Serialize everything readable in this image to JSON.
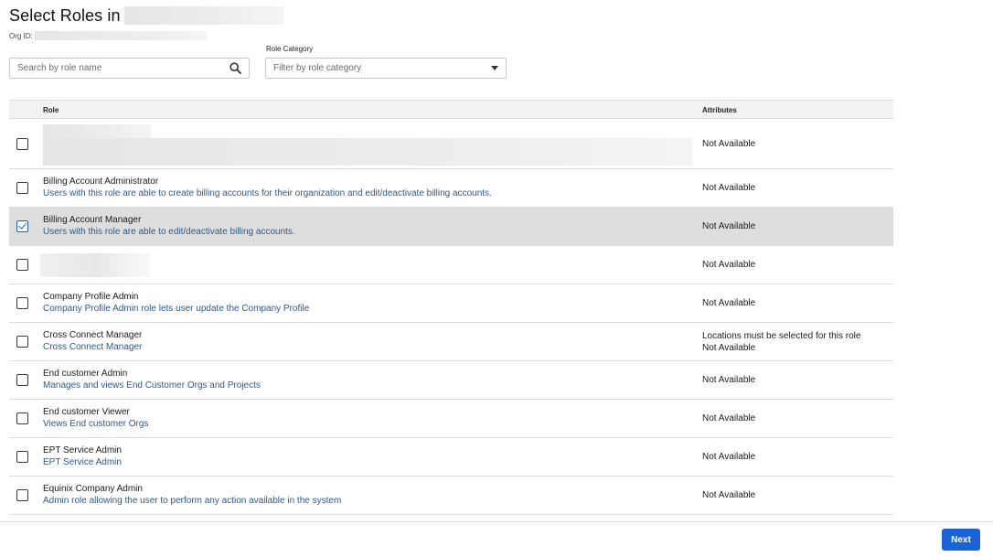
{
  "header": {
    "title": "Select Roles in",
    "org_id_label": "Org ID:"
  },
  "filters": {
    "search_placeholder": "Search by role name",
    "category_label": "Role Category",
    "category_placeholder": "Filter by role category"
  },
  "table": {
    "columns": {
      "role": "Role",
      "attributes": "Attributes"
    },
    "rows": [
      {
        "name": "",
        "description": "",
        "attributes": [
          "Not Available"
        ],
        "checked": false,
        "redacted": true
      },
      {
        "name": "Billing Account Administrator",
        "description": "Users with this role are able to create billing accounts for their organization and edit/deactivate billing accounts.",
        "attributes": [
          "Not Available"
        ],
        "checked": false
      },
      {
        "name": "Billing Account Manager",
        "description": "Users with this role are able to edit/deactivate billing accounts.",
        "attributes": [
          "Not Available"
        ],
        "checked": true
      },
      {
        "name": "",
        "description": "",
        "attributes": [
          "Not Available"
        ],
        "checked": false,
        "redacted": true
      },
      {
        "name": "Company Profile Admin",
        "description": "Company Profile Admin role lets user update the Company Profile",
        "attributes": [
          "Not Available"
        ],
        "checked": false
      },
      {
        "name": "Cross Connect Manager",
        "description": "Cross Connect Manager",
        "attributes": [
          "Locations must be selected for this role",
          "Not Available"
        ],
        "checked": false
      },
      {
        "name": "End customer Admin",
        "description": "Manages and views End Customer Orgs and Projects",
        "attributes": [
          "Not Available"
        ],
        "checked": false
      },
      {
        "name": "End customer Viewer",
        "description": "Views End customer Orgs",
        "attributes": [
          "Not Available"
        ],
        "checked": false
      },
      {
        "name": "EPT Service Admin",
        "description": "EPT Service Admin",
        "attributes": [
          "Not Available"
        ],
        "checked": false
      },
      {
        "name": "Equinix Company Admin",
        "description": "Admin role allowing the user to perform any action available in the system",
        "attributes": [
          "Not Available"
        ],
        "checked": false
      }
    ]
  },
  "footer": {
    "next_label": "Next"
  },
  "colors": {
    "primary": "#1a63d6",
    "link_text": "#2b5a8a",
    "selected_row": "#dedede",
    "header_bg": "#f2f2f2"
  }
}
